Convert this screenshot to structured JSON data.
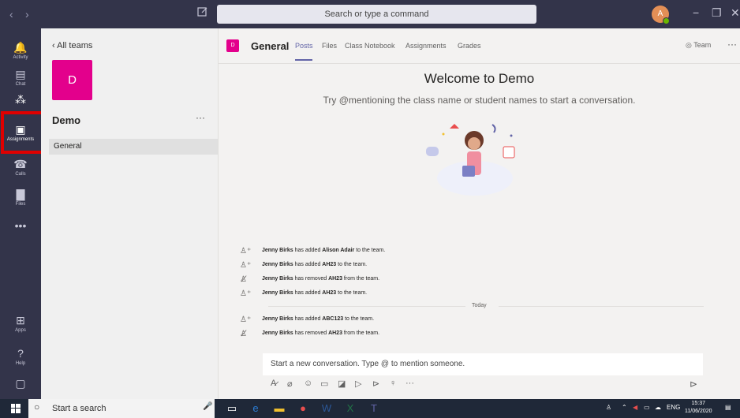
{
  "titlebar": {
    "back_icon": "‹",
    "forward_icon": "›",
    "search_placeholder": "Search or type a command",
    "avatar_initial": "A",
    "minimize": "−",
    "maximize": "❐",
    "close": "✕"
  },
  "appbar": {
    "items": [
      {
        "label": "Activity",
        "icon": "🔔"
      },
      {
        "label": "Chat",
        "icon": "▤"
      },
      {
        "label": "",
        "icon": "⁂"
      },
      {
        "label": "Assignments",
        "icon": "▣"
      },
      {
        "label": "Calls",
        "icon": "☎"
      },
      {
        "label": "Files",
        "icon": "▇"
      },
      {
        "label": "",
        "icon": "•••"
      }
    ],
    "bottom_items": [
      {
        "label": "Apps",
        "icon": "⊞"
      },
      {
        "label": "Help",
        "icon": "?"
      },
      {
        "label": "",
        "icon": "▢"
      }
    ]
  },
  "teampanel": {
    "back_label": "All teams",
    "team_initial": "D",
    "team_name": "Demo",
    "more": "···",
    "channel": "General"
  },
  "header": {
    "tile_initial": "D",
    "title": "General",
    "tabs": [
      "Posts",
      "Files",
      "Class Notebook",
      "Assignments",
      "Grades"
    ],
    "team_button": "Team",
    "more": "···"
  },
  "main": {
    "welcome_title": "Welcome to Demo",
    "welcome_sub": "Try @mentioning the class name or student names to start a conversation.",
    "activity": [
      {
        "actor": "Jenny Birks",
        "action": "has added",
        "target": "Alison Adair",
        "suffix": "to the team."
      },
      {
        "actor": "Jenny Birks",
        "action": "has added",
        "target": "AH23",
        "suffix": "to the team."
      },
      {
        "actor": "Jenny Birks",
        "action": "has removed",
        "target": "AH23",
        "suffix": "from the team."
      },
      {
        "actor": "Jenny Birks",
        "action": "has added",
        "target": "AH23",
        "suffix": "to the team."
      },
      {
        "actor": "Jenny Birks",
        "action": "has added",
        "target": "ABC123",
        "suffix": "to the team."
      },
      {
        "actor": "Jenny Birks",
        "action": "has removed",
        "target": "AH23",
        "suffix": "from the team."
      }
    ],
    "today_label": "Today",
    "compose_placeholder": "Start a new conversation. Type @ to mention someone.",
    "more": "···"
  },
  "taskbar": {
    "search_placeholder": "Start a search",
    "lang": "ENG",
    "time": "15:37",
    "date": "11/06/2020"
  },
  "colors": {
    "titlebar": "#33344a",
    "accent": "#6264a7",
    "team_tile": "#e3008c",
    "highlight_box": "#e00000"
  }
}
